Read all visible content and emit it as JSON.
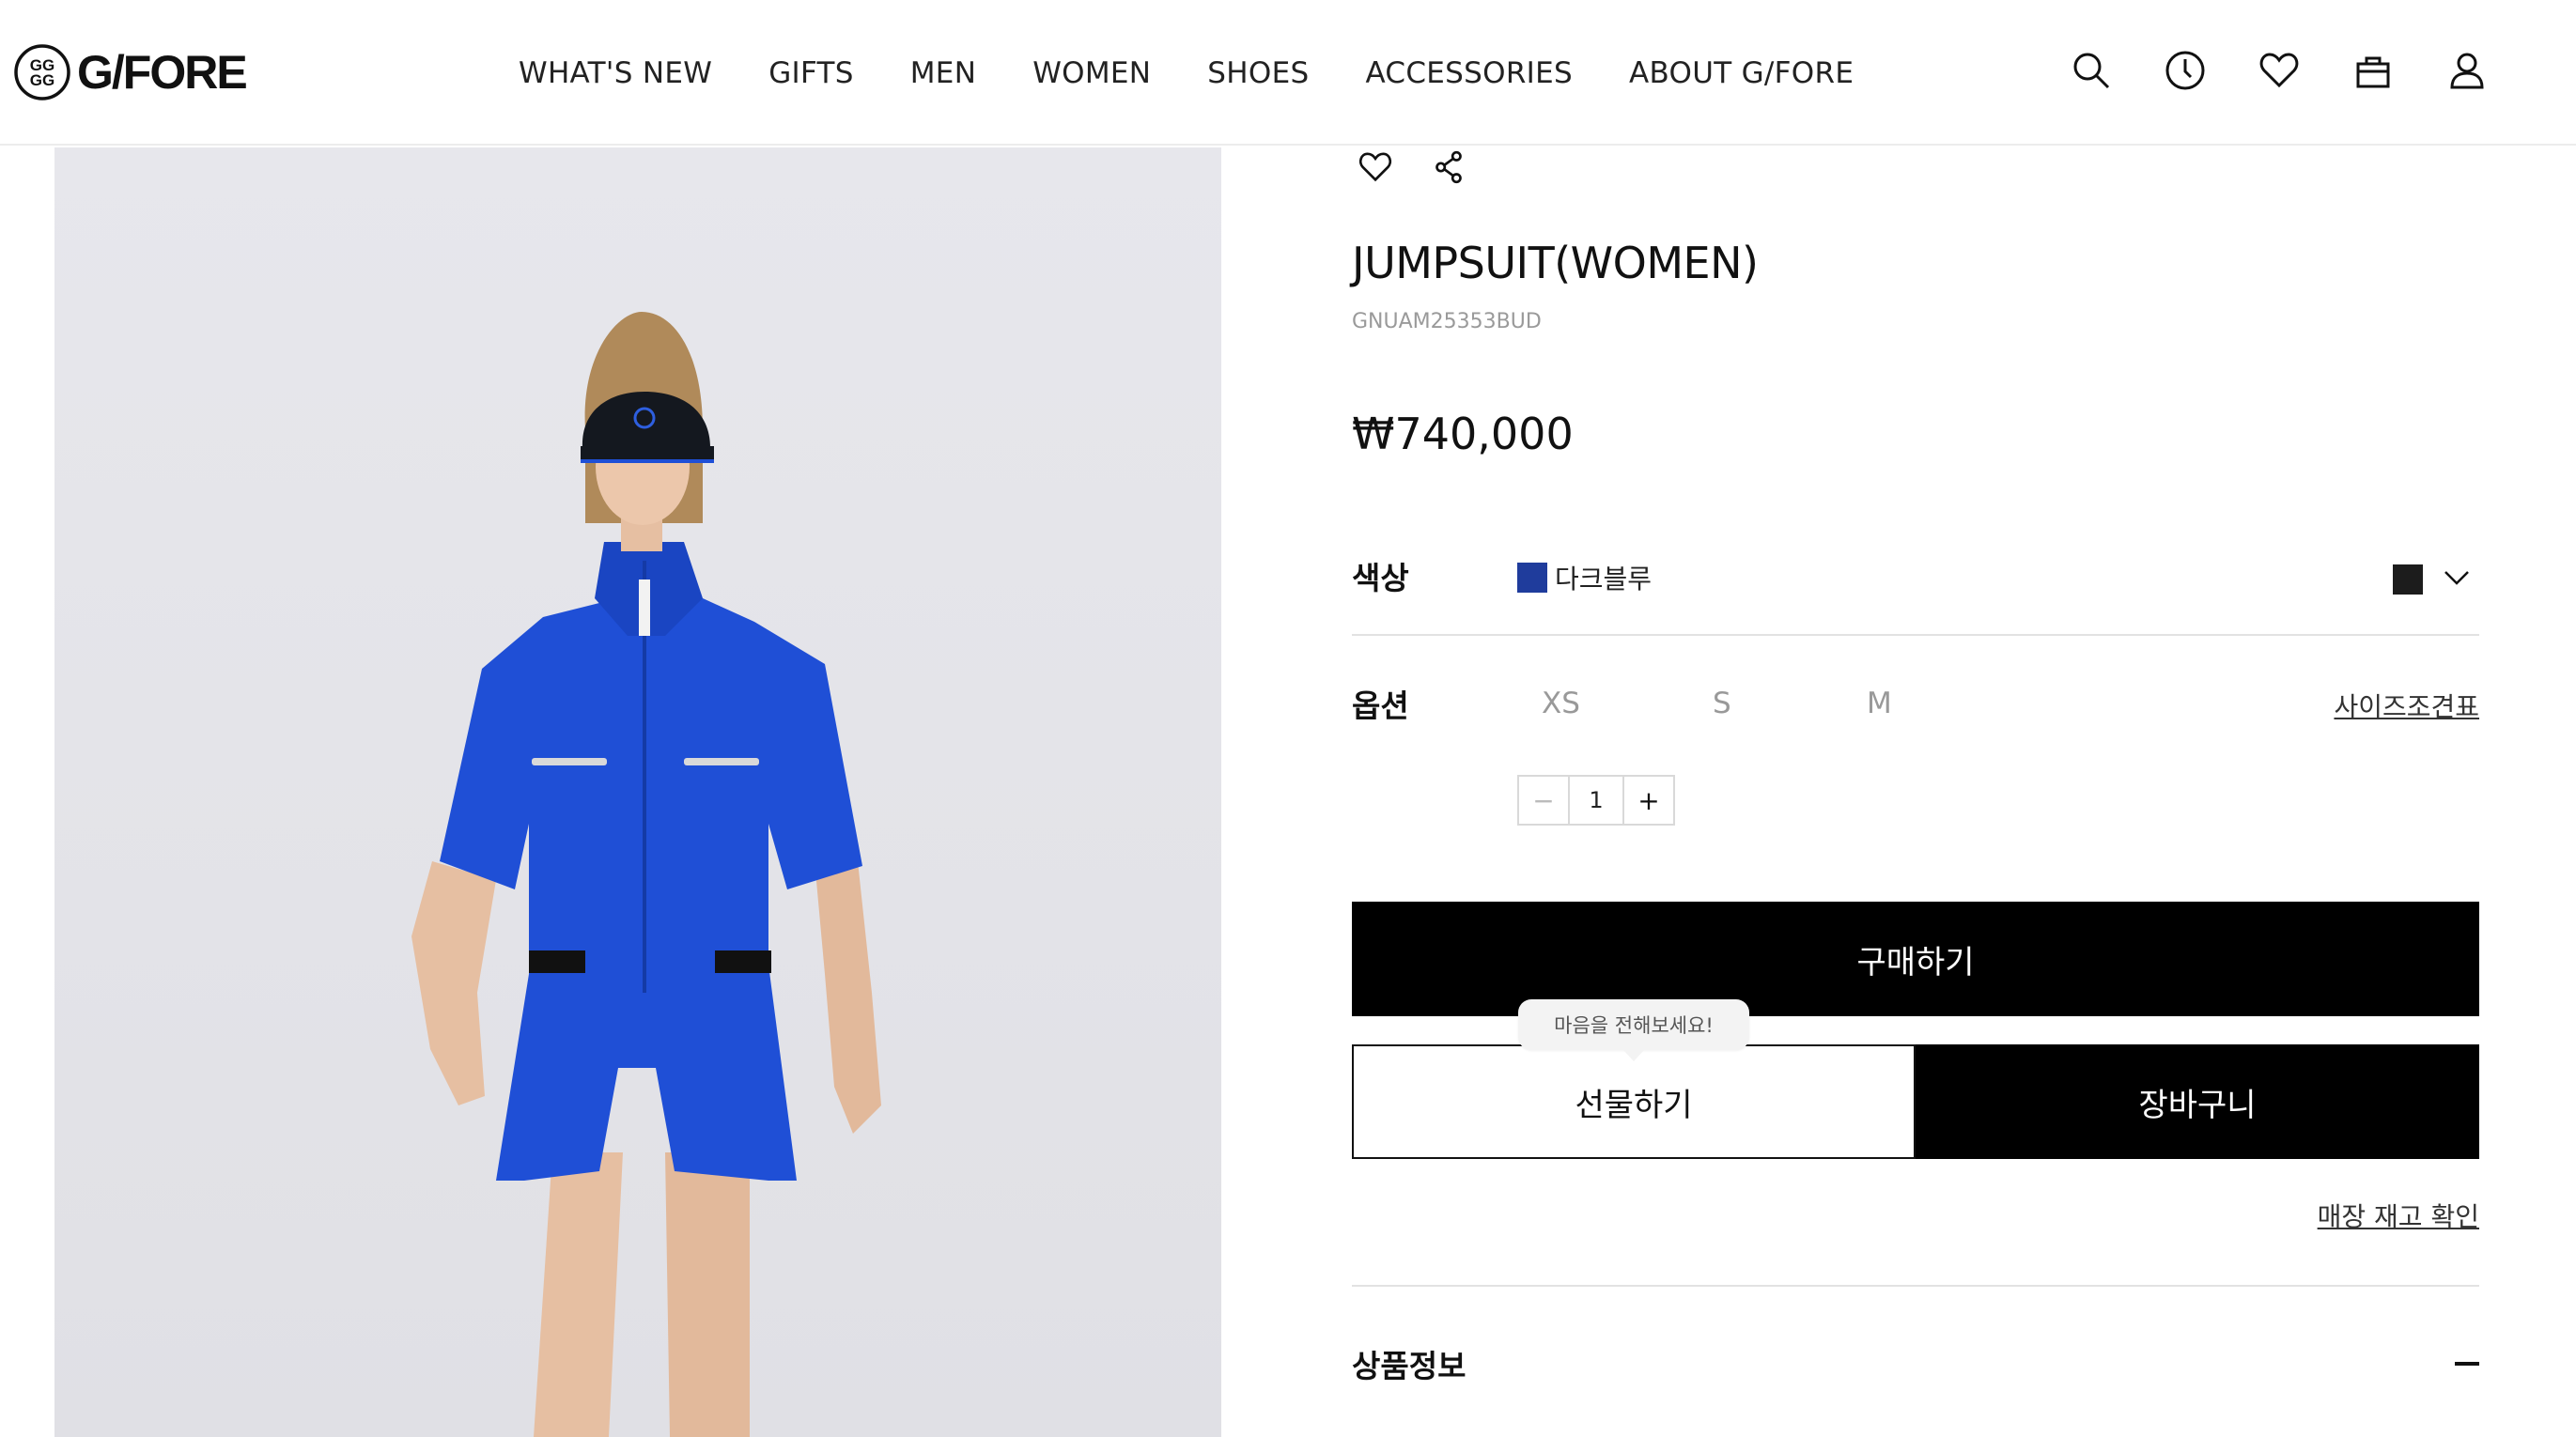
{
  "brand": {
    "logo_text": "G/FORE"
  },
  "nav": {
    "items": [
      "WHAT'S NEW",
      "GIFTS",
      "MEN",
      "WOMEN",
      "SHOES",
      "ACCESSORIES",
      "ABOUT G/FORE"
    ]
  },
  "header_icons": [
    "search-icon",
    "recent-history-icon",
    "wishlist-heart-icon",
    "shopping-bag-icon",
    "account-user-icon"
  ],
  "product": {
    "title": "JUMPSUIT(WOMEN)",
    "sku": "GNUAM25353BUD",
    "price": "₩740,000",
    "image_alt": "model wearing blue short-sleeve jumpsuit and black visor"
  },
  "color": {
    "label": "색상",
    "selected_name": "다크블루",
    "selected_hex": "#1f3c9c",
    "alt_hex": "#1c1c1c"
  },
  "option": {
    "label": "옵션",
    "sizes": [
      "XS",
      "S",
      "M"
    ],
    "size_chart_link": "사이즈조견표"
  },
  "quantity": {
    "minus": "−",
    "value": "1",
    "plus": "+"
  },
  "actions": {
    "buy": "구매하기",
    "gift": "선물하기",
    "cart": "장바구니",
    "gift_tooltip": "마음을 전해보세요!",
    "store_stock_link": "매장 재고 확인"
  },
  "sections": {
    "product_info": "상품정보"
  },
  "colors": {
    "accent_black": "#000000",
    "jumpsuit_blue": "#1f4fd6"
  }
}
